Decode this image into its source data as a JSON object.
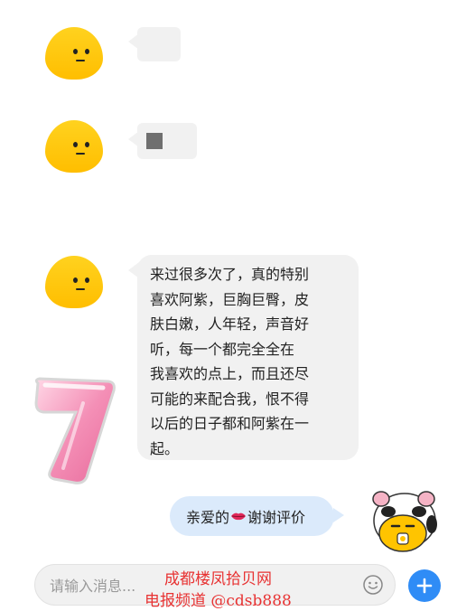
{
  "messages": {
    "long_text_lines": [
      "来过很多次了，真的特别",
      "喜欢阿紫，巨胸巨臀，皮",
      "肤白嫩，人年轻，声音好",
      "听，每一个都完全全在",
      "我喜欢的点上，而且还尽",
      "可能的来配合我，恨不得",
      "以后的日子都和阿紫在一",
      "起。"
    ]
  },
  "reply": {
    "before": "亲爱的",
    "emoji": "lips-emoji",
    "after": "谢谢评价"
  },
  "composer": {
    "placeholder": "请输入消息...",
    "emoji_icon": "smiley-icon",
    "add_icon": "plus-icon"
  },
  "watermark": {
    "line1": "成都楼凤拾贝网",
    "line2": "电报频道 @cdsb888"
  },
  "colors": {
    "avatar_yellow": "#ffc400",
    "incoming_bubble": "#f1f1f1",
    "outgoing_bubble": "#dbeafb",
    "accent_blue": "#2f8cf6",
    "watermark_red": "#e83232"
  }
}
